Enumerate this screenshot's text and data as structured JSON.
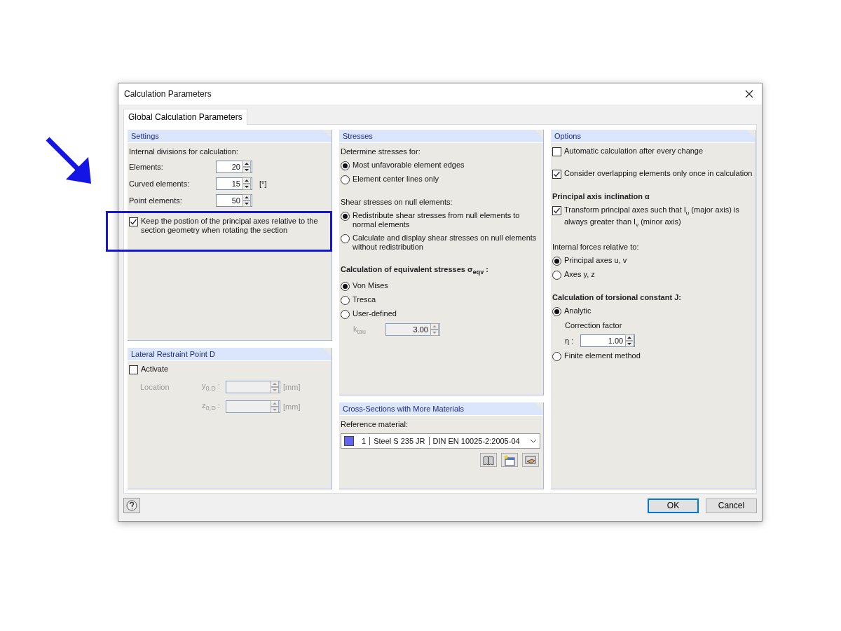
{
  "window": {
    "title": "Calculation Parameters"
  },
  "tabs": [
    {
      "label": "Global Calculation Parameters",
      "selected": true
    }
  ],
  "columns": [
    {
      "panels": [
        {
          "title": "Settings",
          "groups": [
            {
              "items": [
                {
                  "kind": "text",
                  "text": "Internal divisions for calculation:"
                },
                {
                  "kind": "spin",
                  "label": "Elements:",
                  "value": "20"
                },
                {
                  "kind": "spin",
                  "label": "Curved elements:",
                  "value": "15",
                  "unit": "[°]"
                },
                {
                  "kind": "spin",
                  "label": "Point elements:",
                  "value": "50"
                },
                {
                  "kind": "check",
                  "label": "Keep the postion of the principal axes relative to the section geometry when rotating the section",
                  "checked": true,
                  "highlighted": true
                }
              ]
            }
          ]
        },
        {
          "title": "Lateral Restraint Point D",
          "groups": [
            {
              "items": [
                {
                  "kind": "check",
                  "label": "Activate",
                  "checked": false,
                  "highlighted": false
                },
                {
                  "kind": "coord",
                  "caption": "Location",
                  "label": "y$_{0,D}$ :",
                  "unit": "[mm]",
                  "disabled": true
                },
                {
                  "kind": "coord",
                  "label": "z$_{0,D}$ :",
                  "unit": "[mm]",
                  "disabled": true
                }
              ]
            }
          ]
        }
      ]
    },
    {
      "panels": [
        {
          "title": "Stresses",
          "groups": [
            {
              "items": [
                {
                  "kind": "text",
                  "text": "Determine stresses for:"
                },
                {
                  "kind": "radio",
                  "label": "Most unfavorable element edges",
                  "selected": true
                },
                {
                  "kind": "radio",
                  "label": "Element center lines only",
                  "selected": false
                }
              ]
            },
            {
              "items": [
                {
                  "kind": "text",
                  "text": "Shear stresses on null elements:"
                },
                {
                  "kind": "radio",
                  "label": "Redistribute shear stresses from null elements to normal elements",
                  "selected": true
                },
                {
                  "kind": "radio",
                  "label": "Calculate and display shear stresses on null elements without redistribution",
                  "selected": false
                }
              ]
            },
            {
              "items": [
                {
                  "kind": "heading",
                  "text": "Calculation of equivalent stresses σ$_{eqv}$ :"
                },
                {
                  "kind": "radio",
                  "label": "Von Mises",
                  "selected": true
                },
                {
                  "kind": "radio",
                  "label": "Tresca",
                  "selected": false
                },
                {
                  "kind": "radio",
                  "label": "User-defined",
                  "selected": false
                },
                {
                  "kind": "spin",
                  "label": "k$_{tau}$",
                  "value": "3.00",
                  "disabled": true
                }
              ]
            }
          ]
        },
        {
          "title": "Cross-Sections with More Materials",
          "groups": [
            {
              "items": [
                {
                  "kind": "text",
                  "text": "Reference material:"
                },
                {
                  "kind": "material",
                  "color": "#6464f0",
                  "number": "1",
                  "name": "Steel S 235 JR",
                  "standard": "DIN EN 10025-2:2005-04"
                },
                {
                  "kind": "tools"
                }
              ]
            }
          ]
        }
      ]
    },
    {
      "panels": [
        {
          "title": "Options",
          "groups": [
            {
              "items": [
                {
                  "kind": "check",
                  "label": "Automatic calculation after every change",
                  "checked": false,
                  "highlighted": false
                }
              ]
            },
            {
              "items": [
                {
                  "kind": "check",
                  "label": "Consider overlapping elements only once in calculation",
                  "checked": true,
                  "highlighted": false
                }
              ]
            },
            {
              "items": [
                {
                  "kind": "heading",
                  "text": "Principal axis inclination α"
                },
                {
                  "kind": "check",
                  "label": "Transform principal axes such that I$_{u}$ (major axis) is always greater than I$_{v}$ (minor axis)",
                  "checked": true,
                  "highlighted": false
                }
              ]
            },
            {
              "items": [
                {
                  "kind": "text",
                  "text": "Internal forces relative to:"
                },
                {
                  "kind": "radio",
                  "label": "Principal axes u, v",
                  "selected": true
                },
                {
                  "kind": "radio",
                  "label": "Axes y, z",
                  "selected": false
                }
              ]
            },
            {
              "items": [
                {
                  "kind": "heading",
                  "text": "Calculation of torsional constant J:"
                },
                {
                  "kind": "radio",
                  "label": "Analytic",
                  "selected": true,
                  "children": [
                    {
                      "kind": "text",
                      "text": "Correction factor"
                    },
                    {
                      "kind": "spin",
                      "label": "η :",
                      "value": "1.00"
                    }
                  ]
                },
                {
                  "kind": "radio",
                  "label": "Finite element method",
                  "selected": false
                }
              ]
            }
          ]
        }
      ]
    }
  ],
  "buttons": [
    {
      "label": "OK",
      "default": true
    },
    {
      "label": "Cancel",
      "default": false
    }
  ]
}
